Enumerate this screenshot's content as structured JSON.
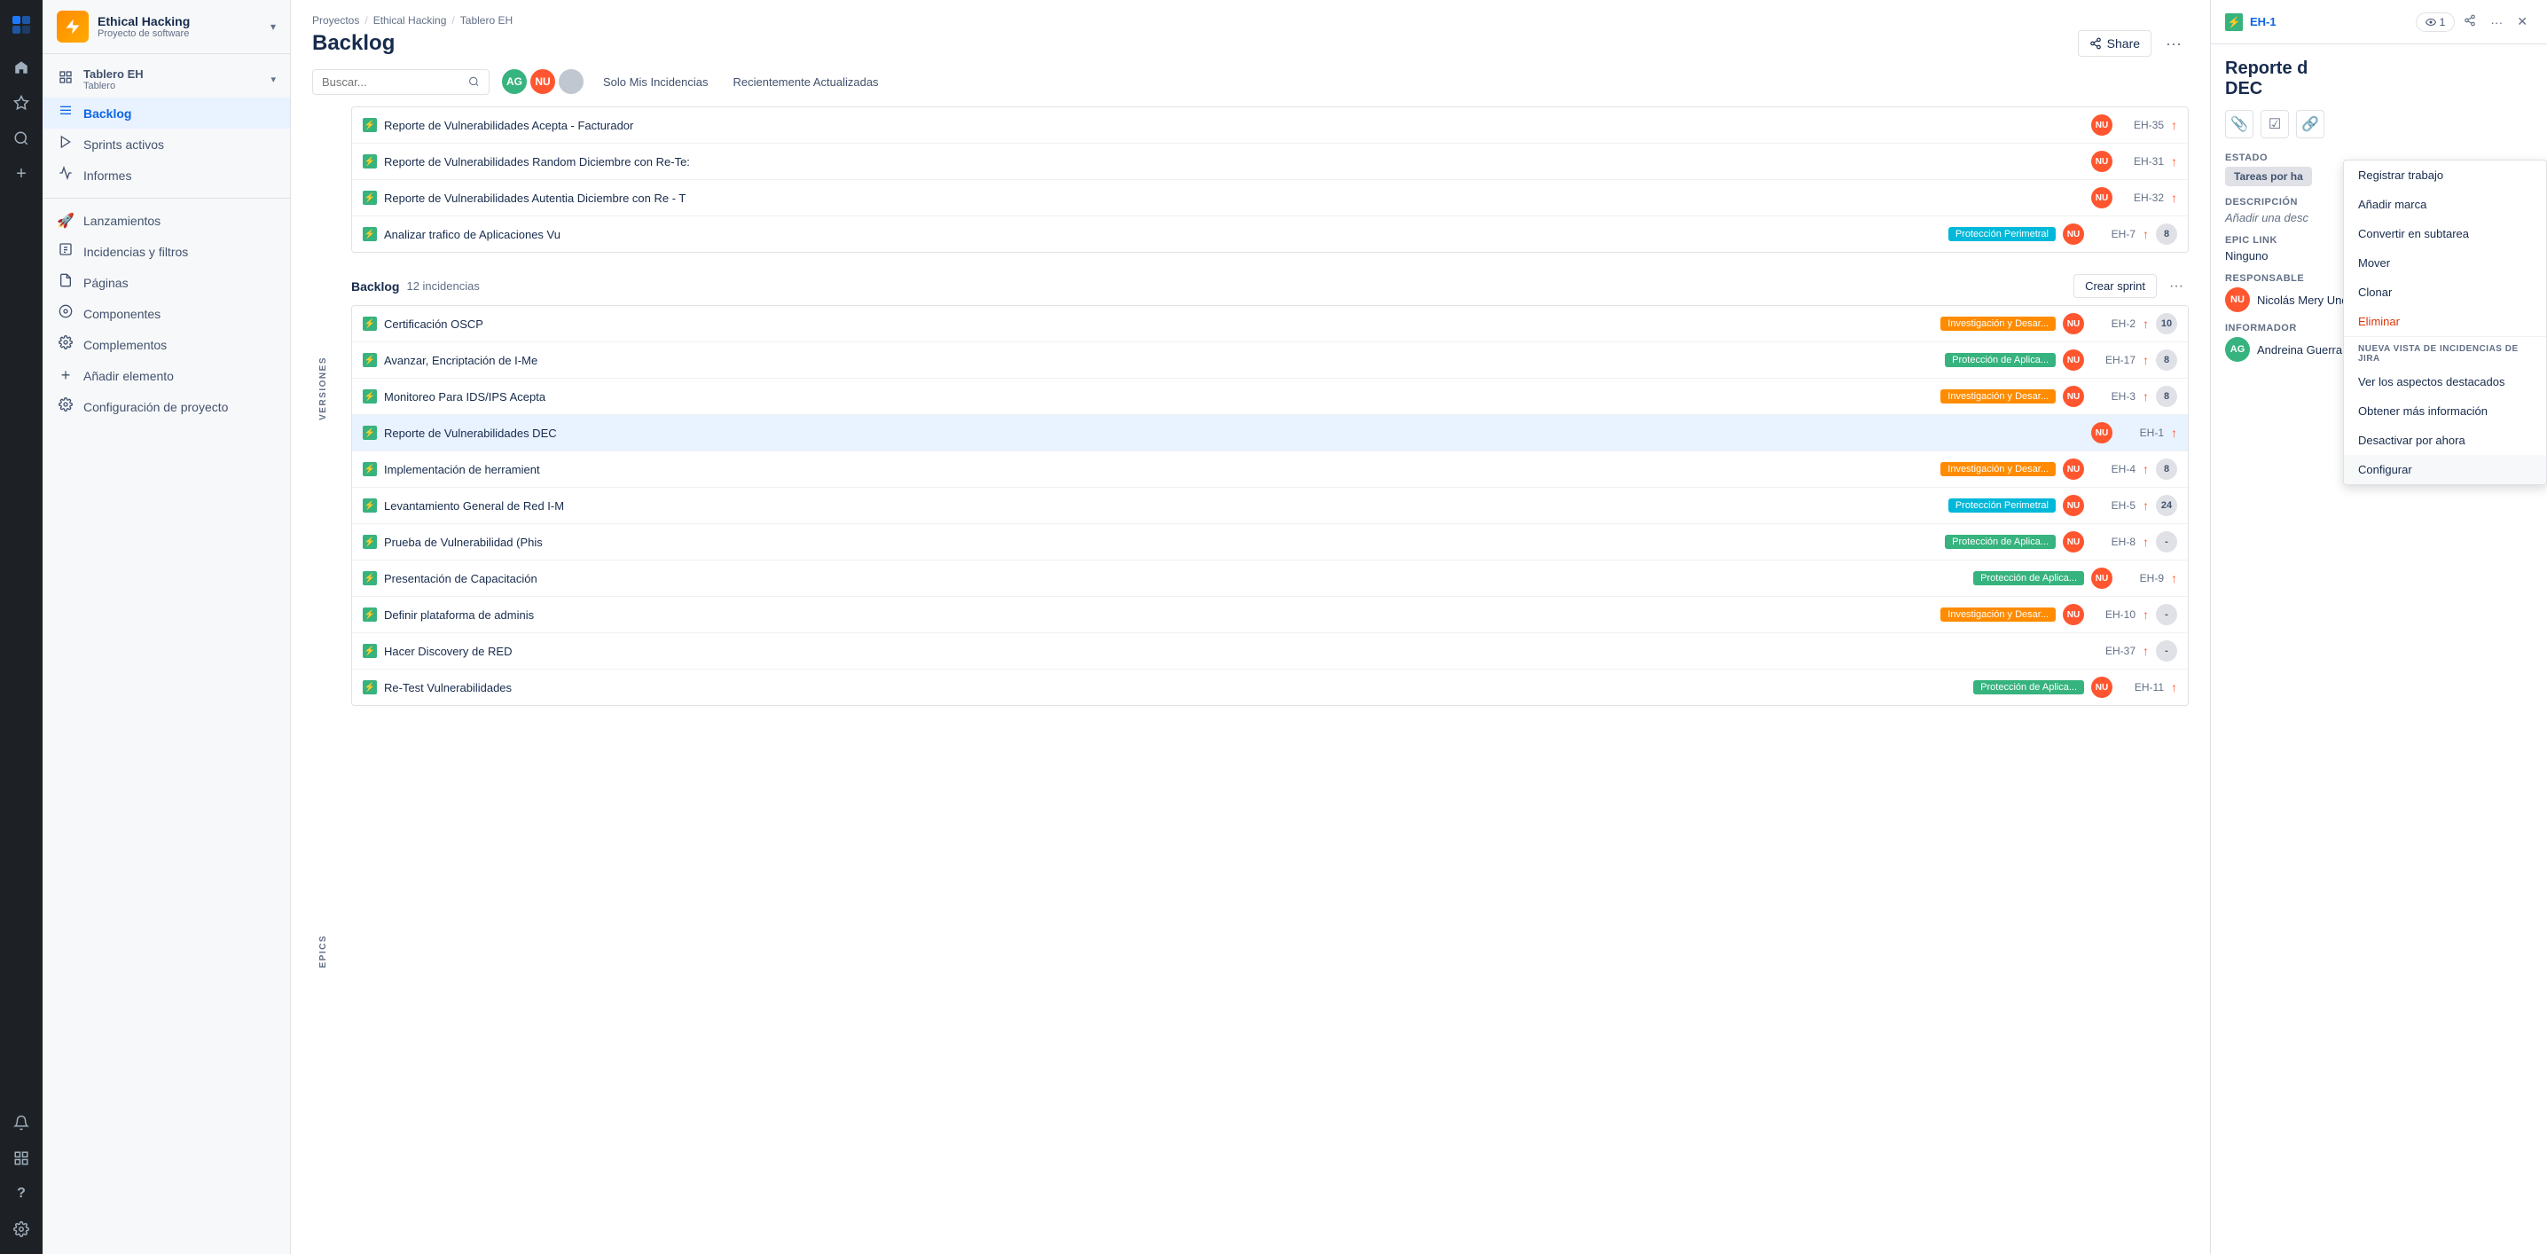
{
  "app": {
    "logo_icon": "⊞"
  },
  "nav_rail": {
    "icons": [
      {
        "name": "home-icon",
        "glyph": "⊞",
        "active": false
      },
      {
        "name": "star-icon",
        "glyph": "☆",
        "active": false
      },
      {
        "name": "search-icon",
        "glyph": "🔍",
        "active": false
      },
      {
        "name": "plus-icon",
        "glyph": "+",
        "active": false
      },
      {
        "name": "bell-icon",
        "glyph": "🔔",
        "active": false
      },
      {
        "name": "grid-icon",
        "glyph": "⊞",
        "active": false
      },
      {
        "name": "help-icon",
        "glyph": "?",
        "active": false
      },
      {
        "name": "settings-icon",
        "glyph": "⚙",
        "active": false
      }
    ]
  },
  "sidebar": {
    "project": {
      "name": "Ethical Hacking",
      "type": "Proyecto de software",
      "icon": "⚡"
    },
    "nav_items": [
      {
        "label": "Tablero EH",
        "sublabel": "Tablero",
        "icon": "▦",
        "active": false,
        "has_chevron": true
      },
      {
        "label": "Backlog",
        "icon": "≡",
        "active": true
      },
      {
        "label": "Sprints activos",
        "icon": "▶",
        "active": false
      },
      {
        "label": "Informes",
        "icon": "📈",
        "active": false
      }
    ],
    "secondary_items": [
      {
        "label": "Lanzamientos",
        "icon": "🚀"
      },
      {
        "label": "Incidencias y filtros",
        "icon": "▤"
      },
      {
        "label": "Páginas",
        "icon": "📄"
      },
      {
        "label": "Componentes",
        "icon": "⊙"
      },
      {
        "label": "Complementos",
        "icon": "🔧"
      },
      {
        "label": "Añadir elemento",
        "icon": "＋"
      },
      {
        "label": "Configuración de proyecto",
        "icon": "⚙"
      }
    ]
  },
  "breadcrumb": {
    "items": [
      "Proyectos",
      "Ethical Hacking",
      "Tablero EH"
    ]
  },
  "page": {
    "title": "Backlog"
  },
  "filters": {
    "search_placeholder": "Buscar...",
    "btn_mis_incidencias": "Solo Mis Incidencias",
    "btn_recientes": "Recientemente Actualizadas"
  },
  "avatars": [
    {
      "initials": "AG",
      "color": "#36b37e"
    },
    {
      "initials": "NU",
      "color": "#ff5630"
    },
    {
      "initials": "?",
      "color": "#c1c7d0"
    }
  ],
  "pre_backlog": {
    "issues": [
      {
        "summary": "Reporte de Vulnerabilidades Acepta - Facturador",
        "assignee": "NU",
        "assignee_color": "#ff5630",
        "key": "EH-35",
        "priority": "↑",
        "points": null
      },
      {
        "summary": "Reporte de Vulnerabilidades Random Diciembre con Re-Te:",
        "assignee": "NU",
        "assignee_color": "#ff5630",
        "key": "EH-31",
        "priority": "↑",
        "points": null
      },
      {
        "summary": "Reporte de Vulnerabilidades Autentia Diciembre con Re - T",
        "assignee": "NU",
        "assignee_color": "#ff5630",
        "key": "EH-32",
        "priority": "↑",
        "points": null
      },
      {
        "summary": "Analizar trafico de Aplicaciones Vu",
        "tag": "Protección Perimetral",
        "tag_class": "tag-proteccion-peri",
        "assignee": "NU",
        "assignee_color": "#ff5630",
        "key": "EH-7",
        "priority": "↑",
        "points": "8"
      }
    ]
  },
  "backlog": {
    "title": "Backlog",
    "count": "12 incidencias",
    "btn_crear_sprint": "Crear sprint",
    "issues": [
      {
        "summary": "Certificación OSCP",
        "tag": "Investigación y Desar...",
        "tag_class": "tag-investigacion",
        "assignee": "NU",
        "assignee_color": "#ff5630",
        "key": "EH-2",
        "priority": "↑",
        "points": "10",
        "selected": false
      },
      {
        "summary": "Avanzar, Encriptación de I-Me",
        "tag": "Protección de Aplica...",
        "tag_class": "tag-proteccion-app",
        "assignee": "NU",
        "assignee_color": "#ff5630",
        "key": "EH-17",
        "priority": "↑",
        "points": "8",
        "selected": false
      },
      {
        "summary": "Monitoreo Para IDS/IPS Acepta",
        "tag": "Investigación y Desar...",
        "tag_class": "tag-investigacion",
        "assignee": "NU",
        "assignee_color": "#ff5630",
        "key": "EH-3",
        "priority": "↑",
        "points": "8",
        "selected": false
      },
      {
        "summary": "Reporte de Vulnerabilidades DEC",
        "tag": null,
        "tag_class": null,
        "assignee": "NU",
        "assignee_color": "#ff5630",
        "key": "EH-1",
        "priority": "↑",
        "points": null,
        "selected": true
      },
      {
        "summary": "Implementación de herramient",
        "tag": "Investigación y Desar...",
        "tag_class": "tag-investigacion",
        "assignee": "NU",
        "assignee_color": "#ff5630",
        "key": "EH-4",
        "priority": "↑",
        "points": "8",
        "selected": false
      },
      {
        "summary": "Levantamiento General de Red I-M",
        "tag": "Protección Perimetral",
        "tag_class": "tag-proteccion-peri",
        "assignee": "NU",
        "assignee_color": "#ff5630",
        "key": "EH-5",
        "priority": "↑",
        "points": "24",
        "selected": false
      },
      {
        "summary": "Prueba de Vulnerabilidad (Phis",
        "tag": "Protección de Aplica...",
        "tag_class": "tag-proteccion-app",
        "assignee": "NU",
        "assignee_color": "#ff5630",
        "key": "EH-8",
        "priority": "↑",
        "points": "-",
        "selected": false
      },
      {
        "summary": "Presentación de Capacitación",
        "tag": "Protección de Aplica...",
        "tag_class": "tag-proteccion-app",
        "assignee": "NU",
        "assignee_color": "#ff5630",
        "key": "EH-9",
        "priority": "↑",
        "points": null,
        "selected": false
      },
      {
        "summary": "Definir plataforma de adminis",
        "tag": "Investigación y Desar...",
        "tag_class": "tag-investigacion",
        "assignee": "NU",
        "assignee_color": "#ff5630",
        "key": "EH-10",
        "priority": "↑",
        "points": "-",
        "selected": false
      },
      {
        "summary": "Hacer Discovery de RED",
        "tag": null,
        "tag_class": null,
        "assignee": null,
        "assignee_color": null,
        "key": "EH-37",
        "priority": "↑",
        "points": "-",
        "selected": false
      },
      {
        "summary": "Re-Test Vulnerabilidades",
        "tag": "...",
        "tag_class": "tag-proteccion-app",
        "assignee": "NU",
        "assignee_color": "#ff5630",
        "key": "EH-11",
        "priority": "↑",
        "points": null,
        "selected": false
      }
    ]
  },
  "right_panel": {
    "issue_key": "EH-1",
    "type_icon": "⚡",
    "watch_count": "1",
    "title_part1": "Reporte d",
    "title_part2": "DEC",
    "estado_label": "ESTADO",
    "estado_value": "Tareas por ha",
    "descripcion_label": "Descripción",
    "descripcion_placeholder": "Añadir una desc",
    "epic_link_label": "EPIC LINK",
    "epic_link_value": "Ninguno",
    "responsable_label": "RESPONSABLE",
    "responsable_name": "Nicolás Mery Undurraga",
    "responsable_initials": "NU",
    "responsable_color": "#ff5630",
    "informador_label": "INFORMADOR",
    "informador_name": "Andreina Guerra",
    "informador_initials": "AG",
    "informador_color": "#36b37e"
  },
  "context_menu": {
    "items": [
      {
        "label": "Registrar trabajo",
        "type": "normal"
      },
      {
        "label": "Añadir marca",
        "type": "normal"
      },
      {
        "label": "Convertir en subtarea",
        "type": "normal"
      },
      {
        "label": "Mover",
        "type": "normal"
      },
      {
        "label": "Clonar",
        "type": "normal"
      },
      {
        "label": "Eliminar",
        "type": "danger"
      }
    ],
    "section_label": "NUEVA VISTA DE INCIDENCIAS DE JIRA",
    "section_items": [
      {
        "label": "Ver los aspectos destacados",
        "type": "normal"
      },
      {
        "label": "Obtener más información",
        "type": "normal"
      },
      {
        "label": "Desactivar por ahora",
        "type": "normal"
      },
      {
        "label": "Configurar",
        "type": "normal"
      }
    ]
  }
}
